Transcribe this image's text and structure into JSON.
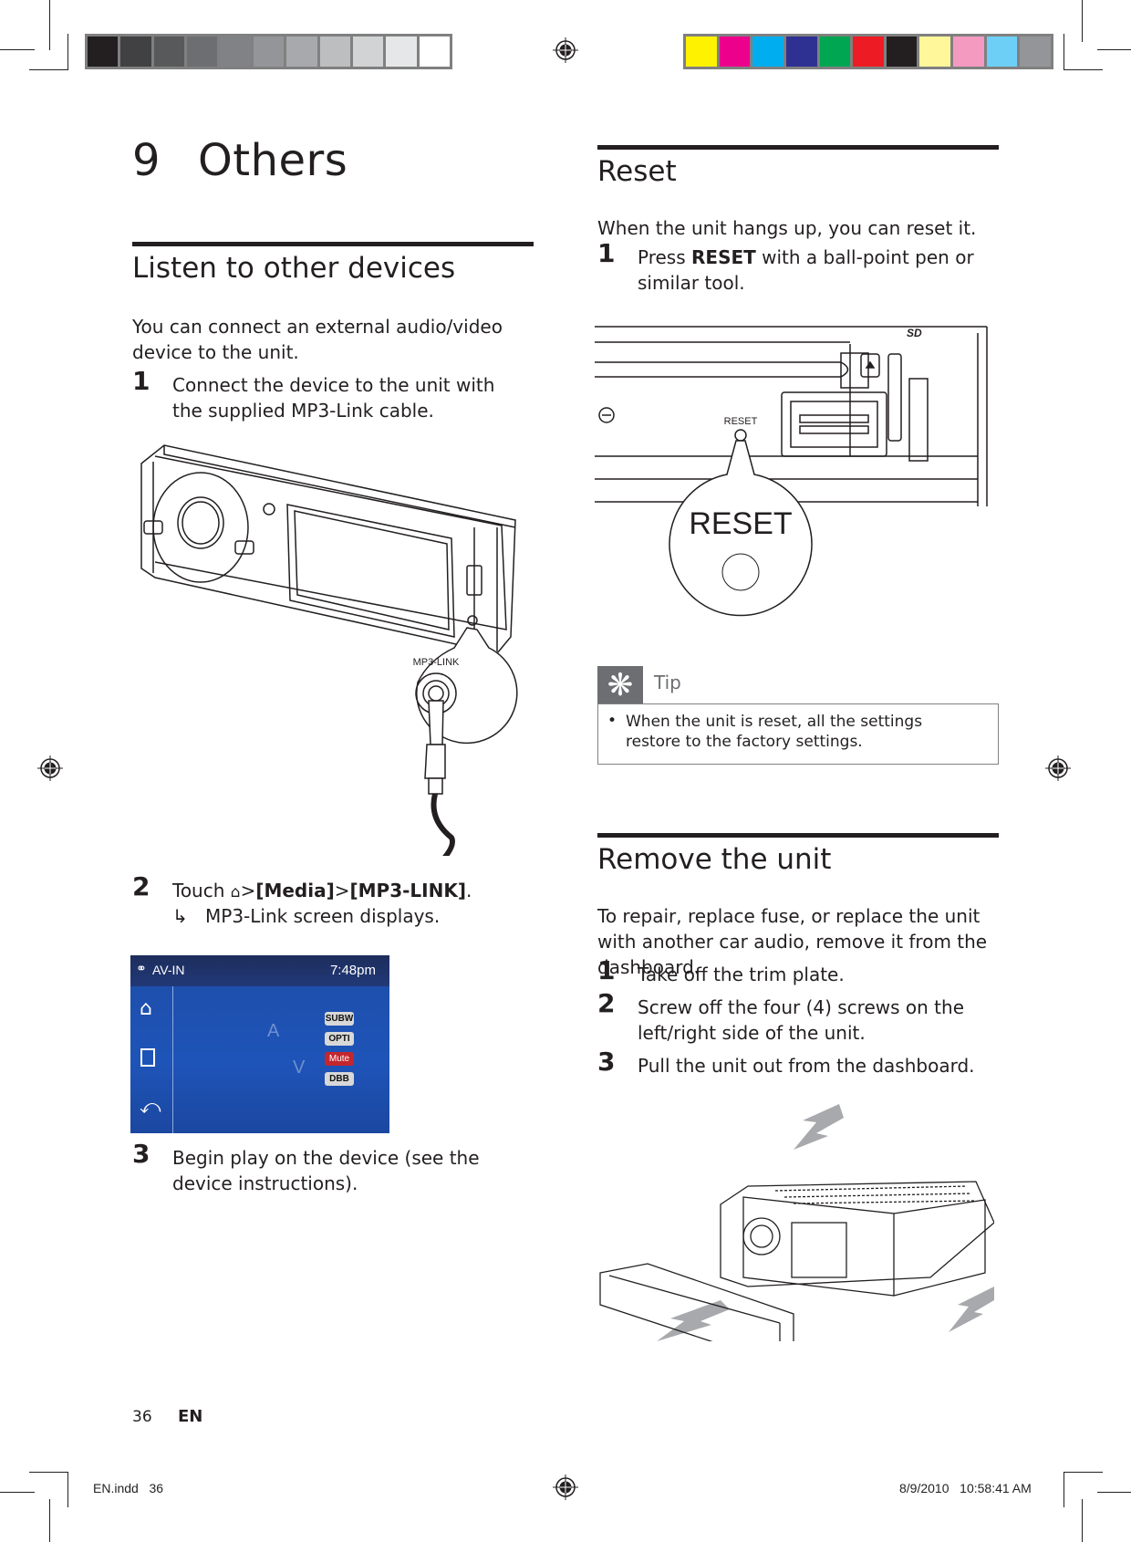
{
  "print_marks": {
    "grayscale_swatches": [
      "#231f20",
      "#414042",
      "#58595b",
      "#6d6e71",
      "#808285",
      "#939598",
      "#a7a9ac",
      "#bcbec0",
      "#d1d3d4",
      "#e6e7e8",
      "#ffffff"
    ],
    "color_swatches": [
      "#fff200",
      "#ec008c",
      "#00aeef",
      "#2e3192",
      "#00a651",
      "#ed1c24",
      "#231f20",
      "#fff799",
      "#f49ac1",
      "#6dcff6",
      "#939598"
    ]
  },
  "chapter": {
    "number": "9",
    "title": "Others"
  },
  "listen_section": {
    "heading": "Listen to other devices",
    "intro": "You can connect an external audio/video device to the unit.",
    "steps": [
      {
        "num": "1",
        "text": "Connect the  device to the unit with the supplied MP3-Link cable."
      },
      {
        "num": "2",
        "text_prefix": "Touch ",
        "home_icon": "home-icon",
        "sep1": ">",
        "bold1": "[Media]",
        "sep2": ">",
        "bold2": "[MP3-LINK]",
        "suffix": ".",
        "result_arrow": "↳",
        "result": "MP3-Link screen displays."
      },
      {
        "num": "3",
        "text": "Begin play on the device (see the device instructions)."
      }
    ],
    "figure_label": "MP3-LINK",
    "screen": {
      "title": "AV-IN",
      "time": "7:48pm",
      "sidebar_icons": [
        "home-icon",
        "list-icon",
        "back-icon"
      ],
      "buttons": [
        {
          "label": "SUBW",
          "active": false
        },
        {
          "label": "OPTI",
          "active": false
        },
        {
          "label": "Mute",
          "active": true
        },
        {
          "label": "DBB",
          "active": false
        }
      ],
      "watermark_letters": [
        "A",
        "V"
      ]
    }
  },
  "reset_section": {
    "heading": "Reset",
    "intro": "When the unit hangs up, you can reset it.",
    "step1_num": "1",
    "step1_prefix": "Press ",
    "step1_bold": "RESET",
    "step1_suffix": " with a ball-point pen or similar tool.",
    "figure_small_label": "RESET",
    "figure_big_label": "RESET",
    "figure_sd_label": "SD",
    "tip": {
      "label": "Tip",
      "bullet": "•",
      "text": "When the unit is reset, all the settings restore to the factory settings."
    }
  },
  "remove_section": {
    "heading": "Remove the unit",
    "intro": "To repair, replace fuse, or replace the unit with another car audio, remove it from the dashboard.",
    "steps": [
      {
        "num": "1",
        "text": "Take off the trim plate."
      },
      {
        "num": "2",
        "text": "Screw off the four (4) screws on the left/right side of the unit."
      },
      {
        "num": "3",
        "text": "Pull the unit out from the dashboard."
      }
    ]
  },
  "footer": {
    "page_number": "36",
    "language": "EN",
    "file_name": "EN.indd   36",
    "timestamp": "8/9/2010   10:58:41 AM"
  }
}
